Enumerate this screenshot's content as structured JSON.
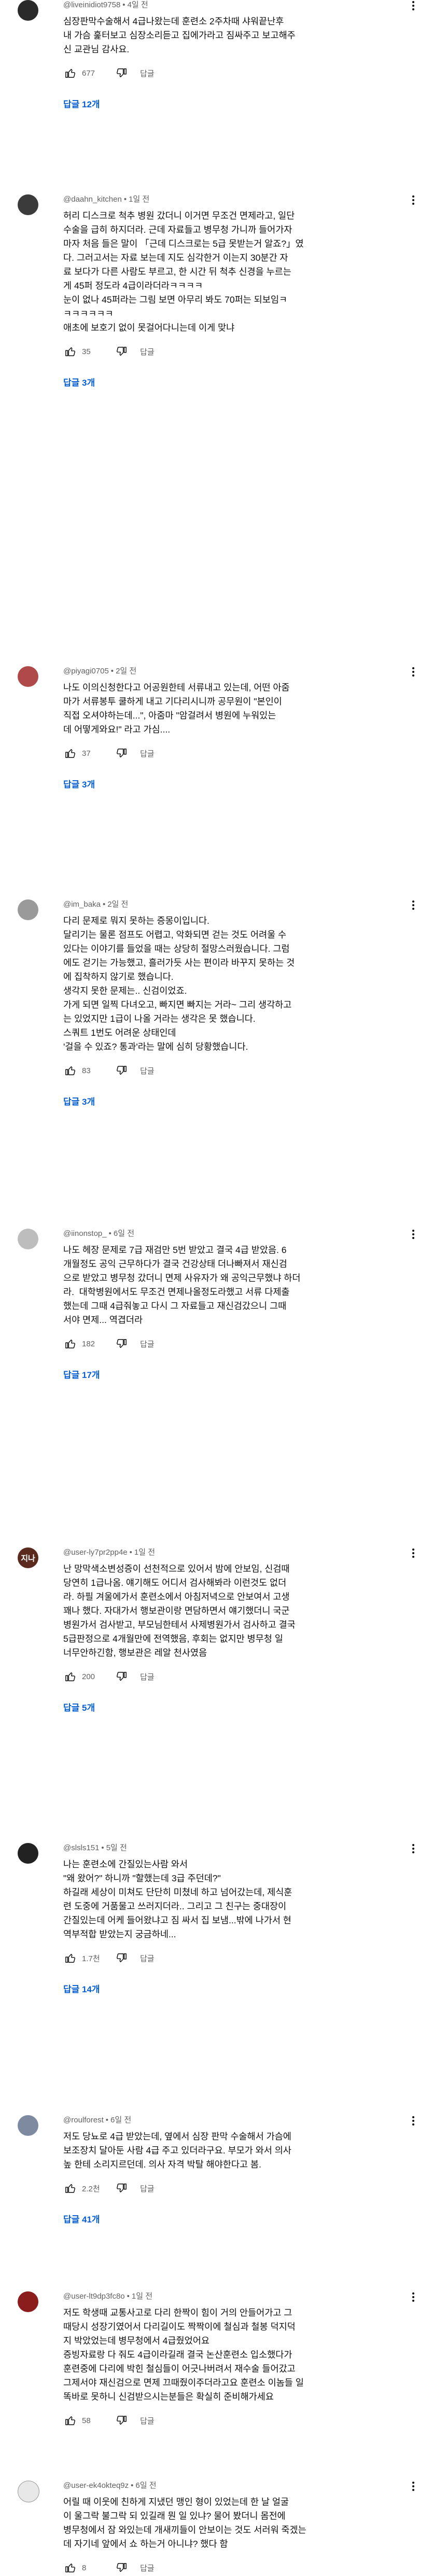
{
  "ui": {
    "reply_label": "답글",
    "more_icon": "more-vert-icon",
    "like_icon": "thumb-up-icon",
    "dislike_icon": "thumb-down-icon"
  },
  "comments": [
    {
      "author": "@liveinidiot9758",
      "time": "4일 전",
      "text": "심장판막수술해서 4급나왔는데 훈련소 2주차때 샤워끝난후\n내 가슴 훑터보고 심장소리듣고 집에가라고 짐싸주고 보고해주\n신 교관님 감사요.",
      "likes": "677",
      "replies": "답글 12개",
      "avatar_color": "#2a2a2a",
      "avatar_initial": ""
    },
    {
      "author": "@daahn_kitchen",
      "time": "1일 전",
      "text": "허리 디스크로 척추 병원 갔더니 이거면 무조건 면제라고, 일단\n수술을 급히 하지더라. 근데 자료들고 병무청 가니까 들어가자\n마자 처음 들은 말이 「근데 디스크로는 5급 못받는거 알죠?」였\n다. 그러고서는 자료 보는데 지도 심각한거 이는지 30분간 자\n료 보다가 다른 사람도 부르고, 한 시간 뒤 척추 신경을 누르는\n게 45퍼 정도라 4급이라더라ㅋㅋㅋㅋ\n눈이 없나 45퍼라는 그림 보면 아무리 봐도 70퍼는 되보임ㅋ\nㅋㅋㅋㅋㅋㅋ\n애초에 보호기 없이 못걸어다니는데 이게 맞냐",
      "likes": "35",
      "replies": "답글 3개",
      "avatar_color": "#3b3b3b",
      "avatar_initial": ""
    },
    {
      "author": "@piyagi0705",
      "time": "2일 전",
      "text": "나도 이의신청한다고 어공원한테 서류내고 있는데, 어떤 아줌\n마가 서류봉투 쿨하게 내고 기다리시니까 공무원이 \"본인이\n직접 오셔야하는데...\", 아줌마 \"암걸려서 병원에 누워있는\n데 어떻게와요!\" 라고 가심....",
      "likes": "37",
      "replies": "답글 3개",
      "avatar_color": "#b04a4a",
      "avatar_initial": ""
    },
    {
      "author": "@im_baka",
      "time": "2일 전",
      "text": "다리 문제로 뭐지 못하는 증몽이입니다.\n달리기는 물론 점프도 어렵고, 악화되면 걷는 것도 어려울 수\n있다는 이야기를 들었을 때는 상당히 절망스러웠습니다. 그럼\n에도 걷기는 가능했고, 흘러가듯 사는 편이라 바꾸지 못하는 것\n에 집착하지 않기로 했습니다.\n생각지 못한 문제는.. 신검이었죠.\n가게 되면 일찍 다녀오고, 빠지면 빠지는 거라~ 그리 생각하고\n는 있었지만 1급이 나올 거라는 생각은 못 했습니다.\n스쿼트 1번도 어려운 상태인데\n'걸을 수 있죠? 통과'라는 말에 심히 당황했습니다.",
      "likes": "83",
      "replies": "답글 3개",
      "avatar_color": "#9a9a9a",
      "avatar_initial": ""
    },
    {
      "author": "@iinonstop_",
      "time": "6일 전",
      "text": "나도 헤장 문제로 7급 재검만 5번 받았고 결국 4급 받았음. 6\n개월정도 공익 근무하다가 결국 건강상태 더나빠져서 재신검\n으로 받았고 병무청 갔더니 면제 사유자가 왜 공익근무했냐 하더\n라.  대학병원에서도 무조건 면제나올정도라했고 서류 다제출\n했는데 그때 4급줘놓고 다시 그 자료들고 재신검갔으니 그때\n서야 면제... 역겹더라",
      "likes": "182",
      "replies": "답글 17개",
      "avatar_color": "#bdbdbd",
      "avatar_initial": ""
    },
    {
      "author": "@user-ly7pr2pp4e",
      "time": "1일 전",
      "text": "난 망막색소변성증이 선천적으로 있어서 밤에 안보임, 신검때\n당연히 1급나옴. 얘기해도 어디서 검사해봐라 이런것도 없더\n라. 하필 겨울에가서 훈련소에서 아침저녁으로 안보여서 고생\n꽤나 했다. 자대가서 행보관이랑 면담하면서 얘기했더니 국군\n병원가서 검사받고, 부모님한테서 사제병원가서 검사하고 결국\n5급판정으로 4개월만에 전역했음, 후회는 없지만 병무청 일\n너무안하긴함, 행보관은 레알 천사였음",
      "likes": "200",
      "replies": "답글 5개",
      "avatar_color": "#5a2a1e",
      "avatar_initial": "지나"
    },
    {
      "author": "@slsls151",
      "time": "5일 전",
      "text": "나는 훈련소에 간질있는사람 와서\n\"왜 왔어?\" 하니까 \"할했는데 3급 주던데?\"\n하길래 세상이 미쳐도 단단히 미쳤네 하고 넘어갔는데, 제식훈\n련 도중에 거품물고 쓰러지더라.. 그리고 그 친구는 중대장이\n간질있는데 어케 들어왔냐고 짐 싸서 집 보냄...밖에 나가서 현\n역부적합 받았는지 궁금하네...",
      "likes": "1.7천",
      "replies": "답글 14개",
      "avatar_color": "#222222",
      "avatar_initial": ""
    },
    {
      "author": "@roulforest",
      "time": "6일 전",
      "text": "저도 당뇨로 4급 받았는데, 옆에서 심장 판막 수술해서 가슴에\n보조장치 달아둔 사람 4급 주고 있더라구요. 부모가 와서 의사\n높 한테 소리지르던데. 의사 자격 박탈 해야한다고 봄.",
      "likes": "2.2천",
      "replies": "답글 41개",
      "avatar_color": "#7d8aa0",
      "avatar_initial": ""
    },
    {
      "author": "@user-lt9dp3fc8o",
      "time": "1일 전",
      "text": "저도 학생때 교통사고로 다리 한짝이 힘이 거의 안들어가고 그\n때당시 성장기였어서 다리길이도 짝짝이에 철심과 철봉 덕지덕\n지 박았었는데 병무청에서 4급줬었어요\n증빙자료랑 다 줘도 4급이라길래 결국 논산훈련소 입소했다가\n훈련중에 다리에 박힌 철심들이 어긋나버려서 재수술 들어갔고\n그제서야 재신검으로 면제 끄때줬이주더라고요 훈련소 이놈들 일\n똑바로 못하니 신검받으시는분들은 확실히 준비해가세요",
      "likes": "58",
      "replies": "",
      "avatar_color": "#8b1d1d",
      "avatar_initial": ""
    },
    {
      "author": "@user-ek4okteq9z",
      "time": "6일 전",
      "text": "어릴 때 이웃에 친하게 지냈던 맹인 형이 있었는데 한 날 얼굴\n이 울그락 불그락 되 있길래 뭔 일 있냐? 물어 봤더니 몸전에\n병무청에서 잠 와있는데 개새끼들이 안보이는 것도 서러워 죽겠는\n데 자기네 앞에서 쇼 하는거 아니냐? 했다 함",
      "likes": "8",
      "replies": "",
      "avatar_color": "#e8e8e8",
      "avatar_initial": ""
    }
  ]
}
